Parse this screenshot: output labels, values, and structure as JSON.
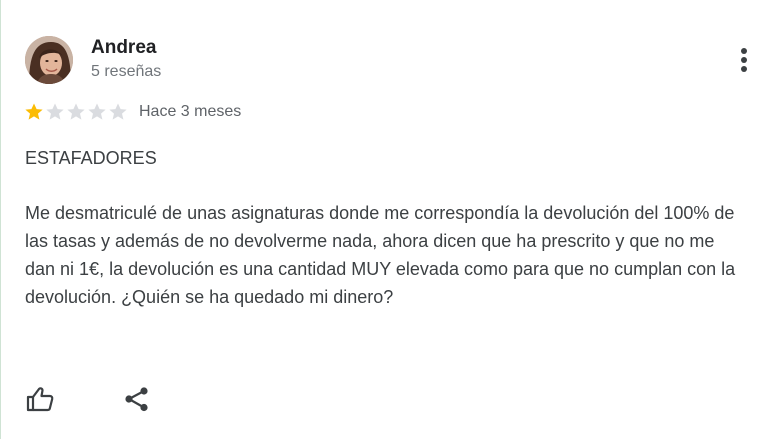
{
  "review": {
    "reviewer_name": "Andrea",
    "review_count": "5 reseñas",
    "rating": 1,
    "max_rating": 5,
    "date": "Hace 3 meses",
    "text": "ESTAFADORES\n\nMe desmatriculé de unas asignaturas donde me correspondía la devolución del 100% de las tasas y además de no devolverme nada, ahora dicen que ha prescrito y que no me dan ni 1€, la devolución es una cantidad MUY elevada como para que no cumplan con la devolución. ¿Quién se ha quedado mi dinero?"
  },
  "icons": {
    "avatar": "avatar-photo",
    "more": "more-vertical-icon",
    "star": "star-icon",
    "like": "thumbs-up-icon",
    "share": "share-icon"
  },
  "colors": {
    "star_filled": "#fbbc04",
    "star_empty": "#dadce0",
    "text": "#3c4043",
    "secondary_text": "#70757a",
    "left_rule": "#cfe3d4"
  }
}
